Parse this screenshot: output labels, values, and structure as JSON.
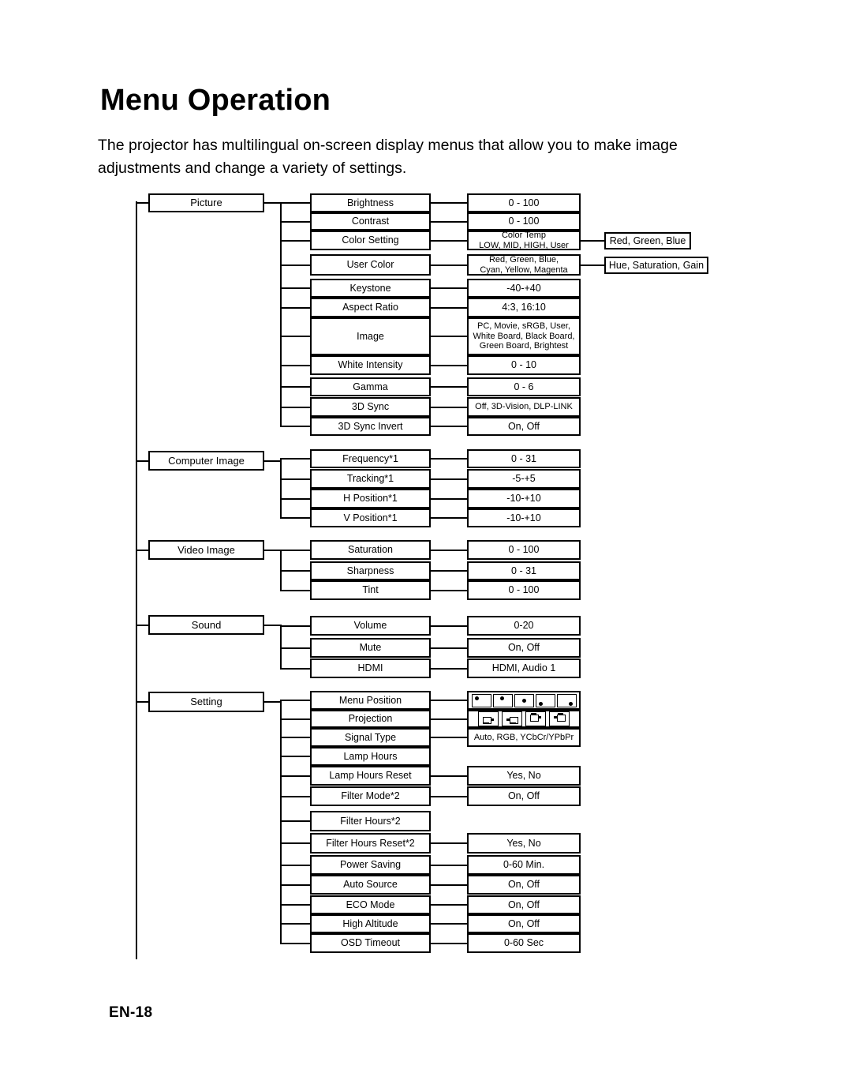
{
  "page": {
    "title": "Menu Operation",
    "intro": "The projector has multilingual on-screen display menus that allow you to make image adjustments and change a variety of settings.",
    "footer": "EN-18"
  },
  "tree": {
    "sections": [
      {
        "name": "Picture",
        "items": [
          {
            "label": "Brightness",
            "value": "0 - 100"
          },
          {
            "label": "Contrast",
            "value": "0 - 100"
          },
          {
            "label": "Color Setting",
            "value": "Color Temp\nLOW, MID, HIGH, User",
            "sub": "Red, Green, Blue"
          },
          {
            "label": "User Color",
            "value": "Red, Green, Blue,\nCyan, Yellow, Magenta",
            "sub": "Hue, Saturation, Gain"
          },
          {
            "label": "Keystone",
            "value": "-40-+40"
          },
          {
            "label": "Aspect Ratio",
            "value": "4:3, 16:10"
          },
          {
            "label": "Image",
            "value": "PC, Movie, sRGB, User,\nWhite Board, Black Board,\nGreen Board, Brightest"
          },
          {
            "label": "White Intensity",
            "value": "0 - 10"
          },
          {
            "label": "Gamma",
            "value": "0 - 6"
          },
          {
            "label": "3D Sync",
            "value": "Off, 3D-Vision, DLP-LINK"
          },
          {
            "label": "3D Sync Invert",
            "value": "On, Off"
          }
        ]
      },
      {
        "name": "Computer Image",
        "items": [
          {
            "label": "Frequency*1",
            "value": "0 - 31"
          },
          {
            "label": "Tracking*1",
            "value": "-5-+5"
          },
          {
            "label": "H Position*1",
            "value": "-10-+10"
          },
          {
            "label": "V Position*1",
            "value": "-10-+10"
          }
        ]
      },
      {
        "name": "Video Image",
        "items": [
          {
            "label": "Saturation",
            "value": "0 - 100"
          },
          {
            "label": "Sharpness",
            "value": "0 - 31"
          },
          {
            "label": "Tint",
            "value": "0 - 100"
          }
        ]
      },
      {
        "name": "Sound",
        "items": [
          {
            "label": "Volume",
            "value": "0-20"
          },
          {
            "label": "Mute",
            "value": "On, Off"
          },
          {
            "label": "HDMI",
            "value": "HDMI, Audio 1"
          }
        ]
      },
      {
        "name": "Setting",
        "items": [
          {
            "label": "Menu Position",
            "value": "",
            "icons": "menu-position"
          },
          {
            "label": "Projection",
            "value": "",
            "icons": "projection"
          },
          {
            "label": "Signal Type",
            "value": "Auto, RGB, YCbCr/YPbPr"
          },
          {
            "label": "Lamp Hours",
            "value": null
          },
          {
            "label": "Lamp Hours Reset",
            "value": "Yes, No"
          },
          {
            "label": "Filter Mode*2",
            "value": "On, Off"
          },
          {
            "label": "Filter Hours*2",
            "value": null
          },
          {
            "label": "Filter Hours Reset*2",
            "value": "Yes, No"
          },
          {
            "label": "Power Saving",
            "value": "0-60 Min."
          },
          {
            "label": "Auto Source",
            "value": "On, Off"
          },
          {
            "label": "ECO Mode",
            "value": "On, Off"
          },
          {
            "label": "High Altitude",
            "value": "On, Off"
          },
          {
            "label": "OSD Timeout",
            "value": "0-60 Sec"
          }
        ]
      }
    ]
  }
}
